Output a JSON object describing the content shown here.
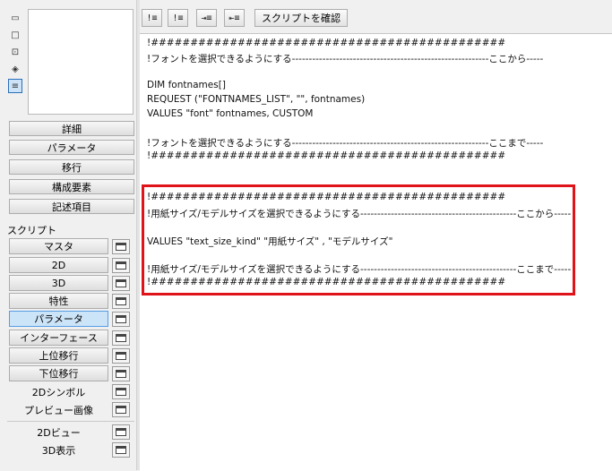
{
  "left_panel": {
    "view_icons": [
      "cursor-icon",
      "square-icon",
      "camera-icon",
      "cube-icon",
      "list-icon"
    ],
    "section_buttons": [
      "詳細",
      "パラメータ",
      "移行",
      "構成要素",
      "記述項目"
    ],
    "script_label": "スクリプト",
    "script_items": [
      {
        "label": "マスタ",
        "active": false
      },
      {
        "label": "2D",
        "active": false
      },
      {
        "label": "3D",
        "active": false
      },
      {
        "label": "特性",
        "active": false
      },
      {
        "label": "パラメータ",
        "active": true
      },
      {
        "label": "インターフェース",
        "active": false
      },
      {
        "label": "上位移行",
        "active": false
      },
      {
        "label": "下位移行",
        "active": false
      },
      {
        "label": "2Dシンボル",
        "active": false
      },
      {
        "label": "プレビュー画像",
        "active": false
      }
    ],
    "view_items": [
      "2Dビュー",
      "3D表示"
    ]
  },
  "toolbar": {
    "icon_buttons": [
      "!≡",
      "!≡",
      "⇥≡",
      "⇤≡"
    ],
    "check_script_label": "スクリプトを確認"
  },
  "editor": {
    "lines": [
      "!#############################################",
      "!フォントを選択できるようにする----------------------------------------------------------ここから-----",
      "",
      "DIM fontnames[]",
      "REQUEST (\"FONTNAMES_LIST\", \"\", fontnames)",
      "VALUES \"font\" fontnames, CUSTOM",
      "",
      "!フォントを選択できるようにする----------------------------------------------------------ここまで-----",
      "!#############################################",
      "",
      "",
      "!#############################################",
      "!用紙サイズ/モデルサイズを選択できるようにする----------------------------------------------ここから-----",
      "",
      "VALUES \"text_size_kind\" \"用紙サイズ\" , \"モデルサイズ\"",
      "",
      "!用紙サイズ/モデルサイズを選択できるようにする----------------------------------------------ここまで-----",
      "!#############################################"
    ]
  },
  "colors": {
    "highlight": "#e0131a",
    "active_bg": "#cce4f7"
  }
}
